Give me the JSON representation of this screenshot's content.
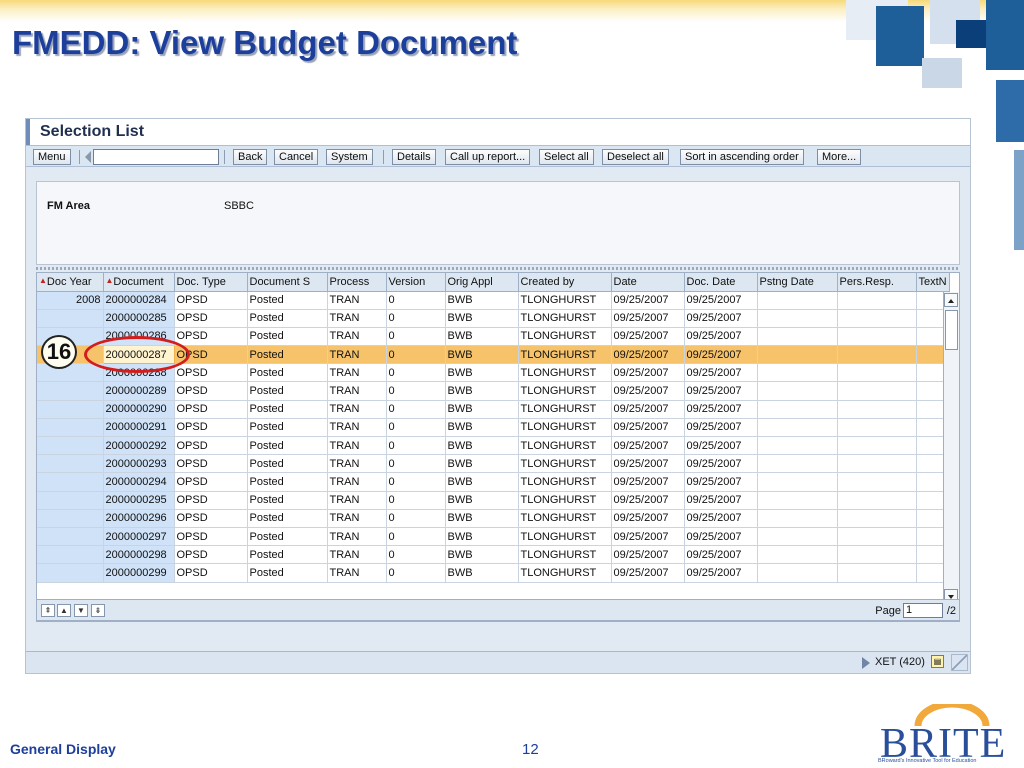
{
  "slide": {
    "title": "FMEDD: View Budget Document",
    "footer_left": "General Display",
    "page_number": "12",
    "callout_number": "16",
    "logo_text": "BRITE",
    "logo_tagline": "BRoward's Innovative Tool for Education"
  },
  "sap": {
    "panel_title": "Selection List",
    "toolbar": {
      "menu": "Menu",
      "back": "Back",
      "cancel": "Cancel",
      "system": "System",
      "details": "Details",
      "call_up_report": "Call up report...",
      "select_all": "Select all",
      "deselect_all": "Deselect all",
      "sort_ascending": "Sort in ascending order",
      "more": "More..."
    },
    "selection": {
      "fm_area_label": "FM Area",
      "fm_area_value": "SBBC"
    },
    "table": {
      "headers": [
        "Doc Year",
        "Document",
        "Doc. Type",
        "Document S",
        "Process",
        "Version",
        "Orig Appl",
        "Created by",
        "Date",
        "Doc. Date",
        "Pstng Date",
        "Pers.Resp.",
        "TextN"
      ],
      "rows": [
        [
          "2008",
          "2000000284",
          "OPSD",
          "Posted",
          "TRAN",
          "0",
          "BWB",
          "TLONGHURST",
          "09/25/2007",
          "09/25/2007",
          "",
          "",
          ""
        ],
        [
          "",
          "2000000285",
          "OPSD",
          "Posted",
          "TRAN",
          "0",
          "BWB",
          "TLONGHURST",
          "09/25/2007",
          "09/25/2007",
          "",
          "",
          ""
        ],
        [
          "",
          "2000000286",
          "OPSD",
          "Posted",
          "TRAN",
          "0",
          "BWB",
          "TLONGHURST",
          "09/25/2007",
          "09/25/2007",
          "",
          "",
          ""
        ],
        [
          "",
          "2000000287",
          "OPSD",
          "Posted",
          "TRAN",
          "0",
          "BWB",
          "TLONGHURST",
          "09/25/2007",
          "09/25/2007",
          "",
          "",
          ""
        ],
        [
          "",
          "2000000288",
          "OPSD",
          "Posted",
          "TRAN",
          "0",
          "BWB",
          "TLONGHURST",
          "09/25/2007",
          "09/25/2007",
          "",
          "",
          ""
        ],
        [
          "",
          "2000000289",
          "OPSD",
          "Posted",
          "TRAN",
          "0",
          "BWB",
          "TLONGHURST",
          "09/25/2007",
          "09/25/2007",
          "",
          "",
          ""
        ],
        [
          "",
          "2000000290",
          "OPSD",
          "Posted",
          "TRAN",
          "0",
          "BWB",
          "TLONGHURST",
          "09/25/2007",
          "09/25/2007",
          "",
          "",
          ""
        ],
        [
          "",
          "2000000291",
          "OPSD",
          "Posted",
          "TRAN",
          "0",
          "BWB",
          "TLONGHURST",
          "09/25/2007",
          "09/25/2007",
          "",
          "",
          ""
        ],
        [
          "",
          "2000000292",
          "OPSD",
          "Posted",
          "TRAN",
          "0",
          "BWB",
          "TLONGHURST",
          "09/25/2007",
          "09/25/2007",
          "",
          "",
          ""
        ],
        [
          "",
          "2000000293",
          "OPSD",
          "Posted",
          "TRAN",
          "0",
          "BWB",
          "TLONGHURST",
          "09/25/2007",
          "09/25/2007",
          "",
          "",
          ""
        ],
        [
          "",
          "2000000294",
          "OPSD",
          "Posted",
          "TRAN",
          "0",
          "BWB",
          "TLONGHURST",
          "09/25/2007",
          "09/25/2007",
          "",
          "",
          ""
        ],
        [
          "",
          "2000000295",
          "OPSD",
          "Posted",
          "TRAN",
          "0",
          "BWB",
          "TLONGHURST",
          "09/25/2007",
          "09/25/2007",
          "",
          "",
          ""
        ],
        [
          "",
          "2000000296",
          "OPSD",
          "Posted",
          "TRAN",
          "0",
          "BWB",
          "TLONGHURST",
          "09/25/2007",
          "09/25/2007",
          "",
          "",
          ""
        ],
        [
          "",
          "2000000297",
          "OPSD",
          "Posted",
          "TRAN",
          "0",
          "BWB",
          "TLONGHURST",
          "09/25/2007",
          "09/25/2007",
          "",
          "",
          ""
        ],
        [
          "",
          "2000000298",
          "OPSD",
          "Posted",
          "TRAN",
          "0",
          "BWB",
          "TLONGHURST",
          "09/25/2007",
          "09/25/2007",
          "",
          "",
          ""
        ],
        [
          "",
          "2000000299",
          "OPSD",
          "Posted",
          "TRAN",
          "0",
          "BWB",
          "TLONGHURST",
          "09/25/2007",
          "09/25/2007",
          "",
          "",
          ""
        ]
      ],
      "selected_row_index": 3
    },
    "pager": {
      "label": "Page",
      "current": "1",
      "total": "/2"
    },
    "status": {
      "system": "XET (420)"
    }
  },
  "colors": {
    "title": "#1d3f9c",
    "selected_row": "#f6c36a",
    "callout_ring": "#d41c1c"
  }
}
